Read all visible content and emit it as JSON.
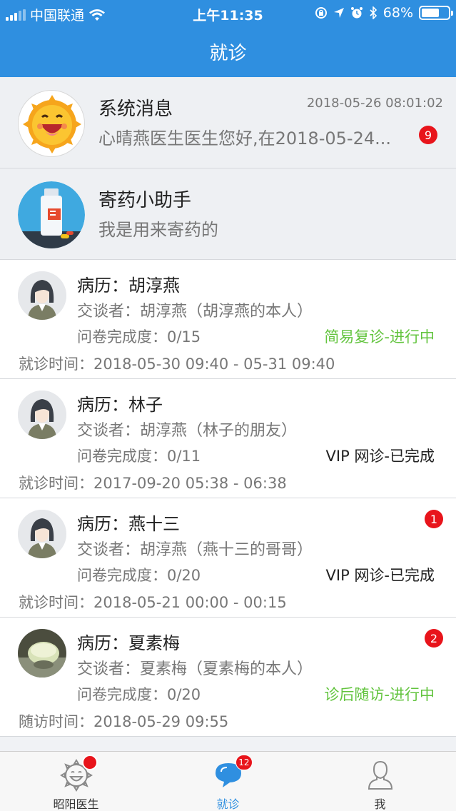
{
  "status_bar": {
    "carrier": "中国联通",
    "time": "上午11:35",
    "battery": "68%",
    "battery_level": 0.68
  },
  "nav": {
    "title": "就诊"
  },
  "system_items": [
    {
      "title": "系统消息",
      "subtitle": "心晴燕医生医生您好,在2018-05-24...",
      "time": "2018-05-26 08:01:02",
      "badge": "9",
      "icon": "sun-mascot-icon"
    },
    {
      "title": "寄药小助手",
      "subtitle": "我是用来寄药的",
      "time": "",
      "badge": "",
      "icon": "medicine-bottle-icon"
    }
  ],
  "cases": [
    {
      "record": "病历：胡淳燕",
      "talker": "交谈者：胡淳燕（胡淳燕的本人）",
      "progress": "问卷完成度：0/15",
      "status": "简易复诊-进行中",
      "status_color": "#63c43f",
      "time": "就诊时间：2018-05-30 09:40 - 05-31 09:40",
      "badge": "",
      "avatar": "female-avatar-icon"
    },
    {
      "record": "病历：林子",
      "talker": "交谈者：胡淳燕（林子的朋友）",
      "progress": "问卷完成度：0/11",
      "status": "VIP 网诊-已完成",
      "status_color": "#222222",
      "time": "就诊时间：2017-09-20 05:38 - 06:38",
      "badge": "",
      "avatar": "female-avatar-icon"
    },
    {
      "record": "病历：燕十三",
      "talker": "交谈者：胡淳燕（燕十三的哥哥）",
      "progress": "问卷完成度：0/20",
      "status": "VIP 网诊-已完成",
      "status_color": "#222222",
      "time": "就诊时间：2018-05-21 00:00 - 00:15",
      "badge": "1",
      "avatar": "female-avatar-icon"
    },
    {
      "record": "病历：夏素梅",
      "talker": "交谈者：夏素梅（夏素梅的本人）",
      "progress": "问卷完成度：0/20",
      "status": "诊后随访-进行中",
      "status_color": "#63c43f",
      "time": "随访时间：2018-05-29 09:55",
      "badge": "2",
      "avatar": "photo-avatar-icon"
    }
  ],
  "tabs": [
    {
      "label": "昭阳医生",
      "icon": "sun-face-icon",
      "badge": ""
    },
    {
      "label": "就诊",
      "icon": "chat-bubbles-icon",
      "badge": "12"
    },
    {
      "label": "我",
      "icon": "person-icon",
      "badge": ""
    }
  ]
}
